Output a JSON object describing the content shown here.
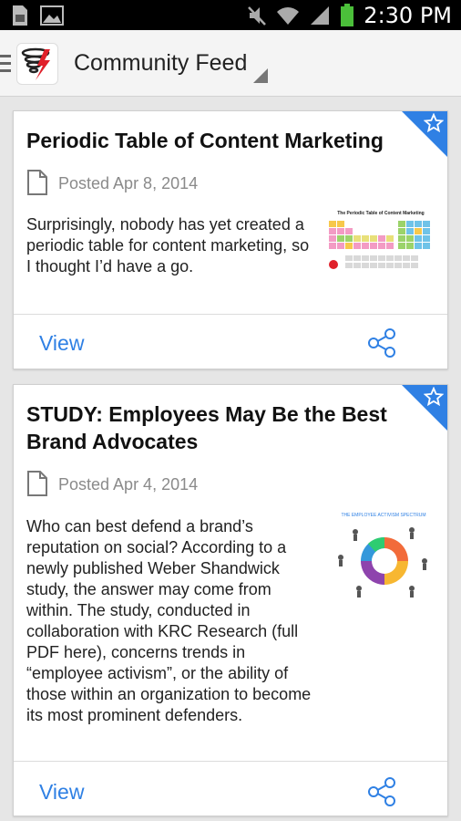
{
  "status_bar": {
    "time": "2:30 PM",
    "icons": [
      "sd-card-icon",
      "image-icon",
      "mute-icon",
      "wifi-icon",
      "signal-icon",
      "battery-icon"
    ]
  },
  "action_bar": {
    "title": "Community Feed"
  },
  "colors": {
    "accent": "#2f80e4",
    "status_bar_bg": "#000000",
    "action_bar_bg": "#f4f4f4",
    "feed_bg": "#e6e6e6",
    "battery": "#4bbf3a"
  },
  "feed": [
    {
      "title": "Periodic Table of Content Marketing",
      "posted": "Posted Apr 8, 2014",
      "excerpt": "Surprisingly, nobody has yet created a periodic table for content marketing, so I thought I’d have a go.",
      "thumb_caption": "The Periodic Table of Content Marketing",
      "view_label": "View"
    },
    {
      "title": "STUDY: Employees May Be the Best Brand Advocates",
      "posted": "Posted Apr 4, 2014",
      "excerpt": "Who can best defend a brand’s reputation on social? According to a newly published Weber Shandwick study, the answer may come from within. The study, conducted in collaboration with KRC Research (full PDF here), concerns trends in “employee activism”, or the ability of those within an organization to become its most prominent defenders.",
      "thumb_caption": "THE EMPLOYEE ACTIVISM SPECTRUM",
      "view_label": "View"
    }
  ]
}
